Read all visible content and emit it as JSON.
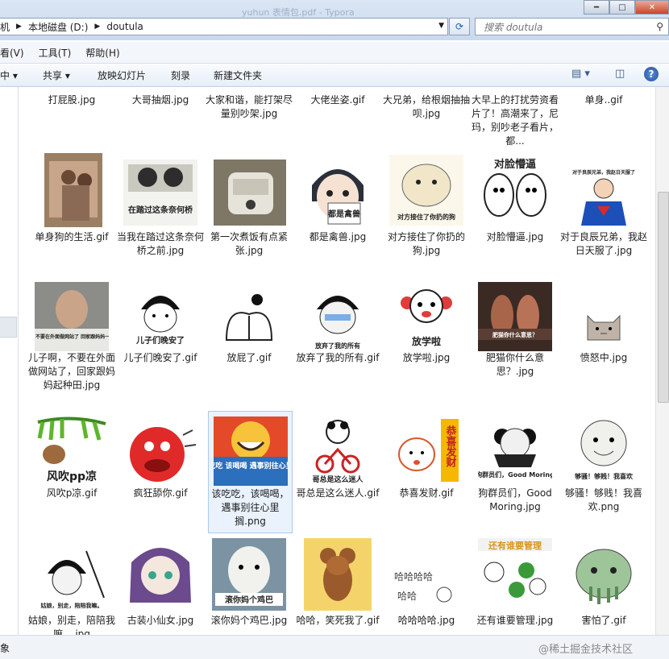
{
  "window": {
    "title": "yuhun 表情包.pdf - Typora"
  },
  "address": {
    "crumbs": [
      "机",
      "本地磁盘 (D:)",
      "doutula"
    ]
  },
  "search": {
    "placeholder": "搜索 doutula"
  },
  "menu": [
    "看(V)",
    "工具(T)",
    "帮助(H)"
  ],
  "toolbar": {
    "organize": "中",
    "share": "共享",
    "slideshow": "放映幻灯片",
    "burn": "刻录",
    "new_folder": "新建文件夹"
  },
  "files": [
    {
      "name": "打屁股.jpg"
    },
    {
      "name": "大哥抽烟.jpg"
    },
    {
      "name": "大家和谐，能打架尽量别吵架.jpg"
    },
    {
      "name": "大佬坐姿.gif"
    },
    {
      "name": "大兄弟，给根烟抽抽呗.jpg"
    },
    {
      "name": "大早上的打扰劳资看片了！高潮来了，尼玛，别吵老子看片，都..."
    },
    {
      "name": "单身..gif"
    },
    {
      "name": "单身狗的生活.gif",
      "caption": ""
    },
    {
      "name": "当我在踏过这条奈何桥之前.jpg",
      "caption": "在踏过这条奈何桥"
    },
    {
      "name": "第一次煮饭有点紧张.jpg",
      "caption": ""
    },
    {
      "name": "都是禽兽.jpg",
      "caption": "都是禽兽"
    },
    {
      "name": "对方接住了你扔的狗.jpg",
      "caption": "对方接住了你扔的狗"
    },
    {
      "name": "对脸懵逼.jpg",
      "caption": "对脸懵逼"
    },
    {
      "name": "对于良辰兄弟，我赵日天服了.jpg",
      "caption": "对于良辰兄弟，我赵日天服了"
    },
    {
      "name": "儿子啊，不要在外面做网站了，回家跟妈妈起种田.jpg",
      "caption": "儿子啊 不要在外面做网站了 回家跟妈妈一起种田"
    },
    {
      "name": "儿子们晚安了.gif",
      "caption": "儿子们晚安了"
    },
    {
      "name": "放屁了.gif",
      "caption": ""
    },
    {
      "name": "放弃了我的所有.gif",
      "caption": "放弃了我的所有"
    },
    {
      "name": "放学啦.jpg",
      "caption": "放学啦"
    },
    {
      "name": "肥猫你什么意思？.jpg",
      "caption": "肥猫你什么意思？"
    },
    {
      "name": "愤怒中.jpg",
      "caption": ""
    },
    {
      "name": "风吹p凉.gif",
      "caption": "风吹pp凉"
    },
    {
      "name": "疯狂舔你.gif",
      "caption": ""
    },
    {
      "name": "该吃吃，该喝喝，遇事别往心里搁.png",
      "caption": "该吃吃 该喝喝 遇事别往心里搁"
    },
    {
      "name": "哥总是这么迷人.gif",
      "caption": "哥总是这么迷人"
    },
    {
      "name": "恭喜发财.gif",
      "caption": "恭喜发财"
    },
    {
      "name": "狗群员们，Good Moring.jpg",
      "caption": "狗群员们，Good Moring"
    },
    {
      "name": "够骚！够贱！我喜欢.png",
      "caption": "够骚！够贱！我喜欢"
    },
    {
      "name": "姑娘，别走，陪陪我嘛....jpg",
      "caption": "姑娘，别走，陪陪我嘛。"
    },
    {
      "name": "古装小仙女.jpg",
      "caption": ""
    },
    {
      "name": "滚你妈个鸡巴.jpg",
      "caption": "滚你妈个鸡巴"
    },
    {
      "name": "哈哈，笑死我了.gif",
      "caption": ""
    },
    {
      "name": "哈哈哈哈.jpg",
      "caption": "哈哈哈哈"
    },
    {
      "name": "还有谁要管理.jpg",
      "caption": "还有谁要管理"
    },
    {
      "name": "害怕了.gif",
      "caption": ""
    }
  ],
  "status": {
    "text": "象",
    "watermark": "@稀土掘金技术社区"
  },
  "colors": {
    "toolbar_bg": "#e6eef9",
    "selection": "#e9f2fd",
    "selection_border": "#a9cbef",
    "close_btn": "#c9462c"
  }
}
